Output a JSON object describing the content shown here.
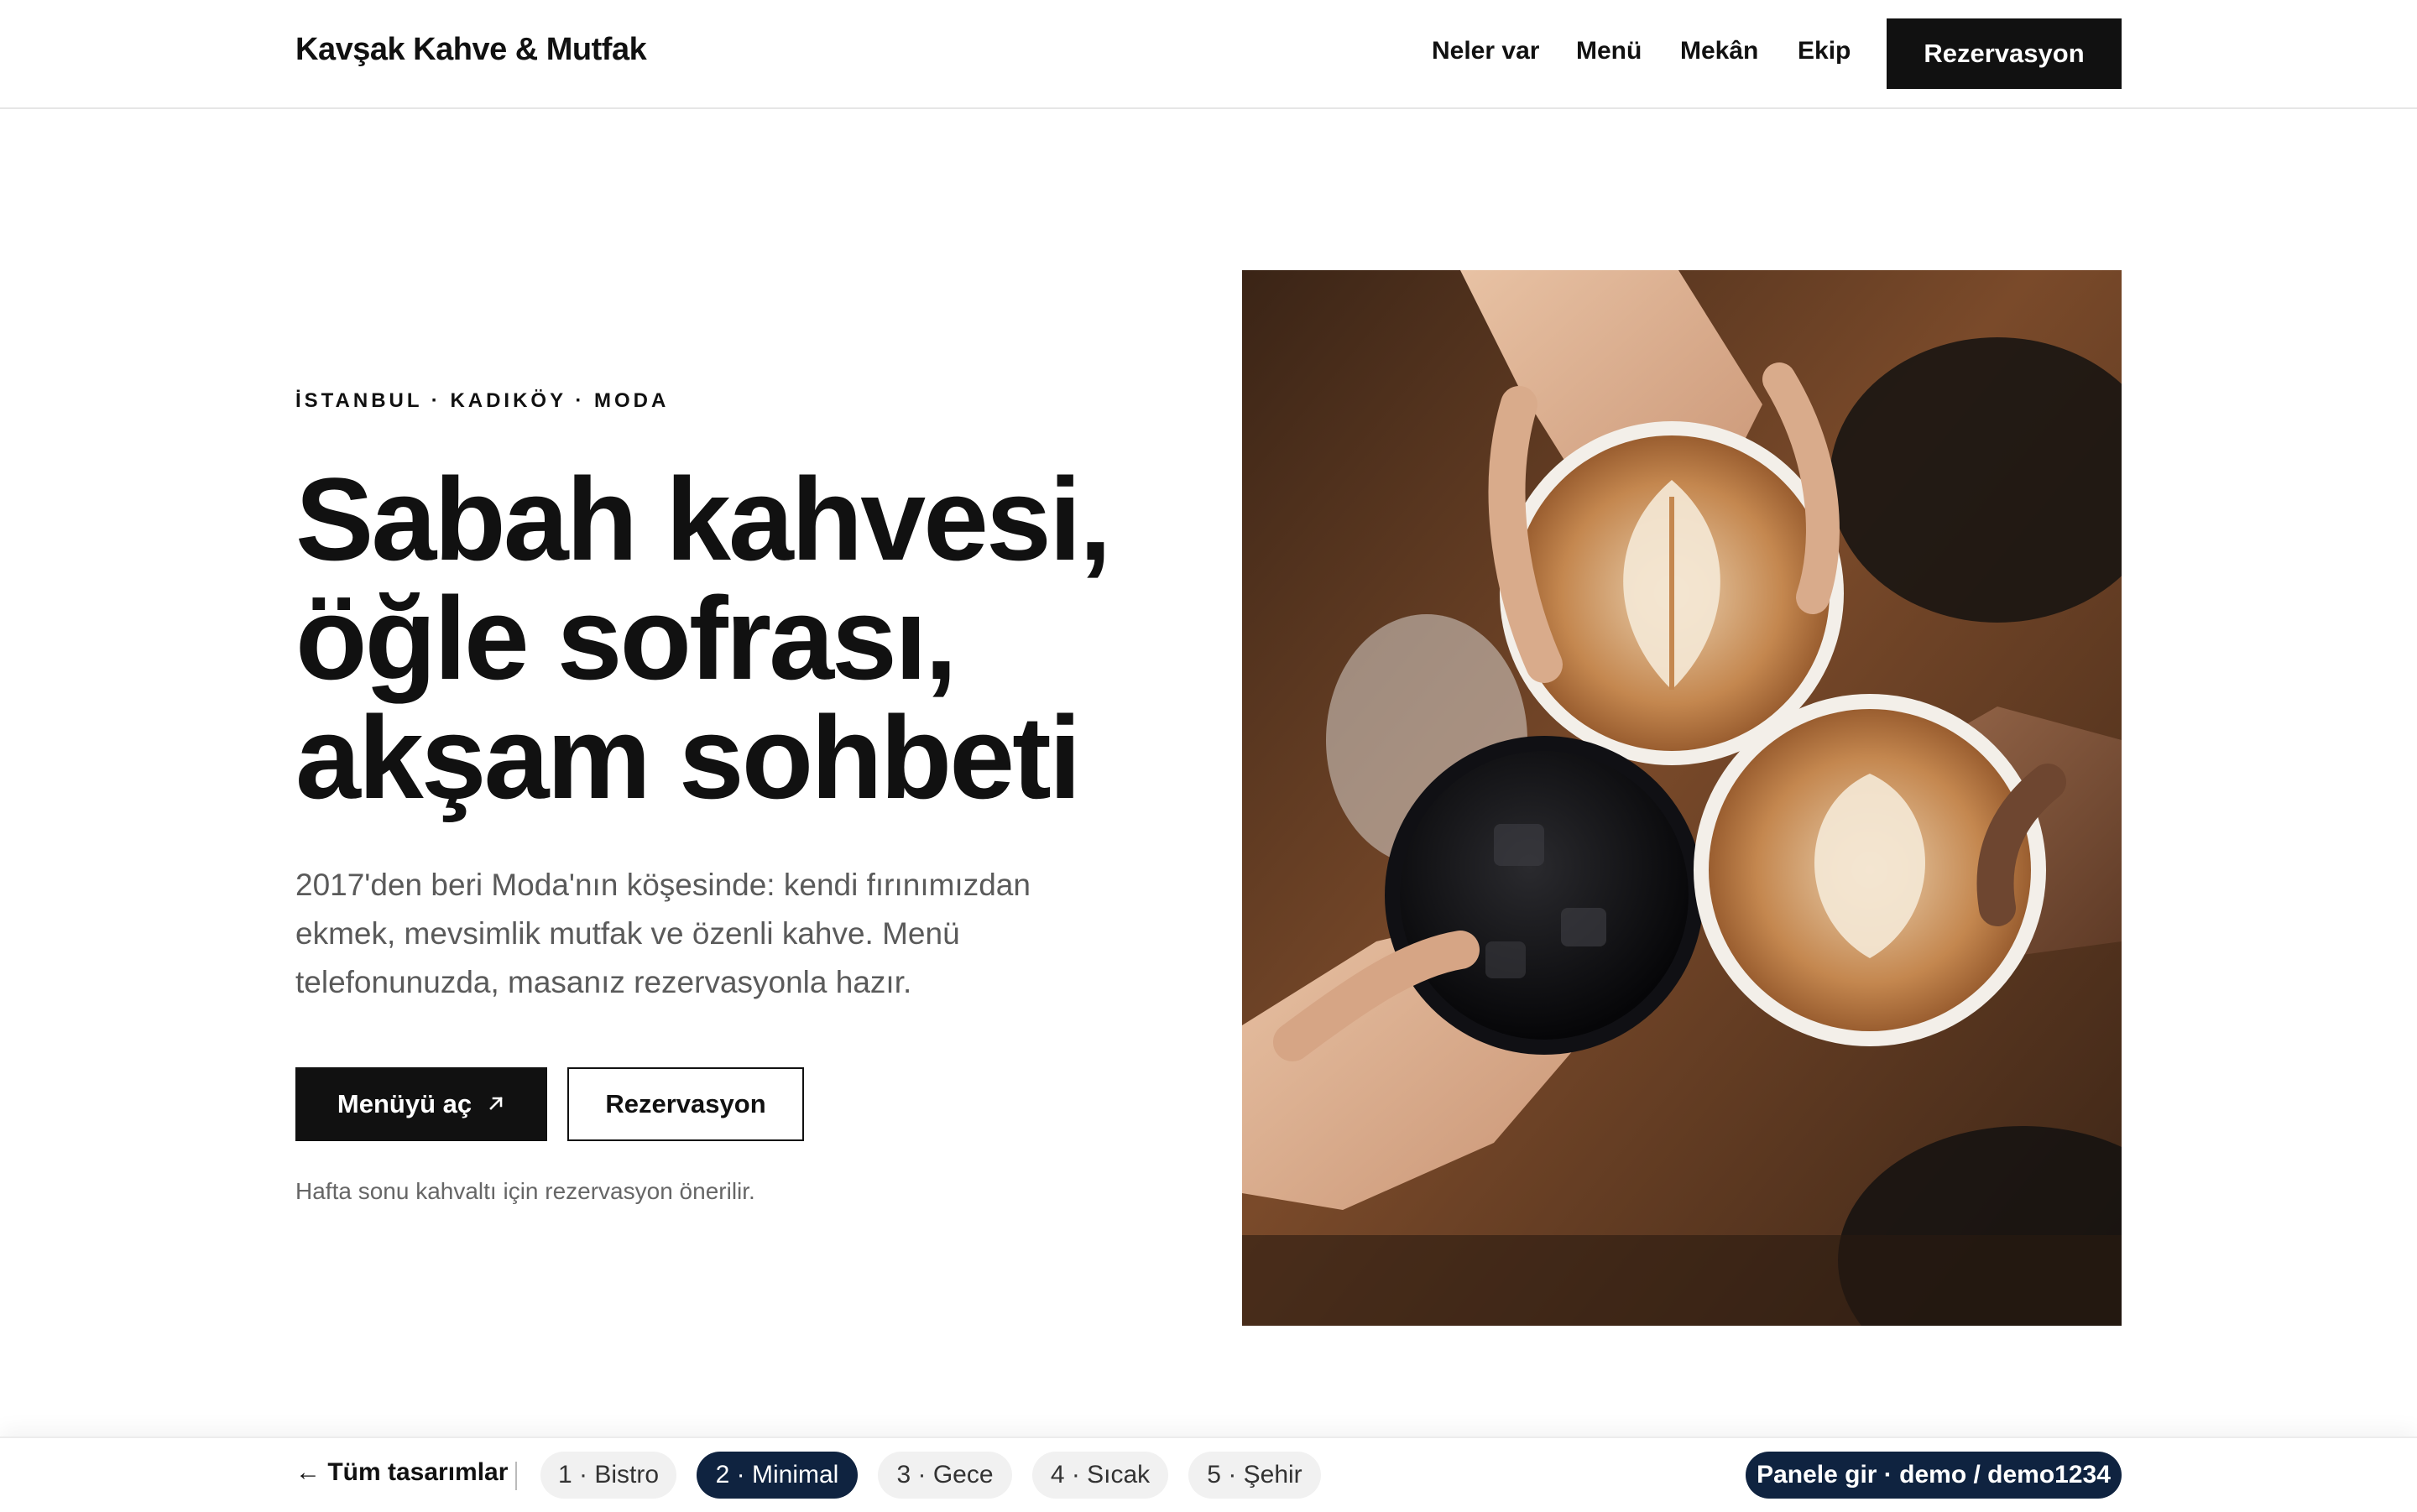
{
  "header": {
    "brand": "Kavşak Kahve & Mutfak",
    "nav": [
      "Neler var",
      "Menü",
      "Mekân",
      "Ekip"
    ],
    "cta": "Rezervasyon"
  },
  "hero": {
    "kicker": "İSTANBUL · KADIKÖY · MODA",
    "headline_lines": [
      "Sabah kahvesi,",
      "öğle sofrası,",
      "akşam sohbeti"
    ],
    "lead": "2017'den beri Moda'nın köşesinde: kendi fırınımızdan ekmek, mevsimlik mutfak ve özenli kahve. Menü telefonunuzda, masanız rezervasyonla hazır.",
    "primary_button": "Menüyü aç",
    "primary_button_icon": "arrow-up-right-icon",
    "secondary_button": "Rezervasyon",
    "note": "Hafta sonu kahvaltı için rezervasyon önerilir."
  },
  "switcher": {
    "back_link": "← Tüm tasarımlar",
    "designs": [
      "1 · Bistro",
      "2 · Minimal",
      "3 · Gece",
      "4 · Sıcak",
      "5 · Şehir"
    ],
    "active_index": 1,
    "panel_button": "Panele gir · demo / demo1234"
  },
  "colors": {
    "ink": "#111111",
    "muted": "#5a5a5a",
    "navy": "#0f2340",
    "pill_bg": "#f1f1f1"
  }
}
